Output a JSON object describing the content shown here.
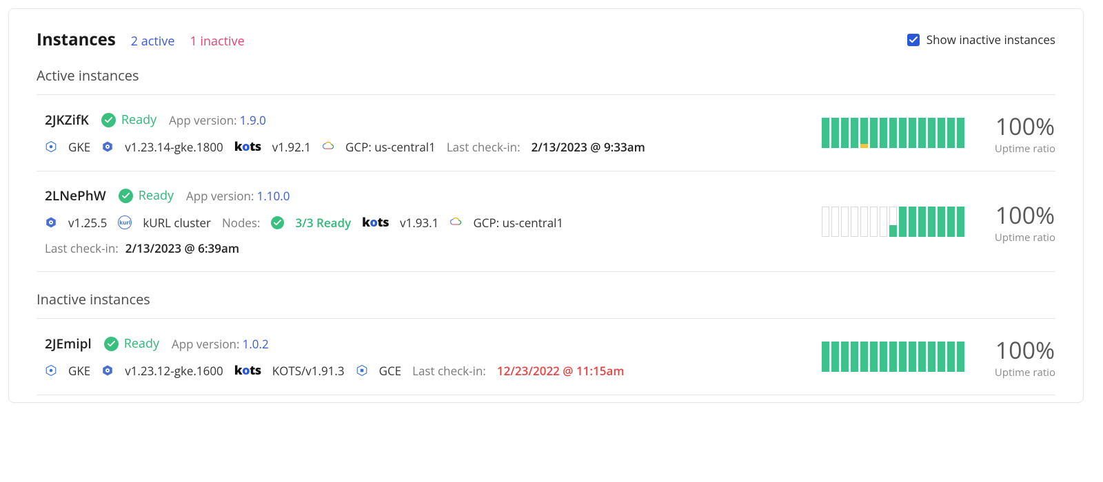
{
  "header": {
    "title": "Instances",
    "active_count": "2 active",
    "inactive_count": "1 inactive",
    "show_inactive_label": "Show inactive instances",
    "show_inactive_checked": true
  },
  "sections": {
    "active_title": "Active instances",
    "inactive_title": "Inactive instances"
  },
  "labels": {
    "app_version": "App version:",
    "nodes": "Nodes:",
    "last_checkin": "Last check-in:",
    "uptime_ratio": "Uptime ratio"
  },
  "instances": {
    "a": {
      "id": "2JKZifK",
      "status": "Ready",
      "app_version": "1.9.0",
      "platform": "GKE",
      "k8s_version": "v1.23.14-gke.1800",
      "kots_version": "v1.92.1",
      "cloud": "GCP: us-central1",
      "last_checkin": "2/13/2023 @ 9:33am",
      "uptime_pct": "100%"
    },
    "b": {
      "id": "2LNePhW",
      "status": "Ready",
      "app_version": "1.10.0",
      "k8s_version": "v1.25.5",
      "cluster_type": "kURL cluster",
      "nodes_ready": "3/3 Ready",
      "kots_version": "v1.93.1",
      "cloud": "GCP: us-central1",
      "last_checkin": "2/13/2023 @ 6:39am",
      "uptime_pct": "100%"
    },
    "c": {
      "id": "2JEmipl",
      "status": "Ready",
      "app_version": "1.0.2",
      "platform": "GKE",
      "k8s_version": "v1.23.12-gke.1600",
      "kots_version": "KOTS/v1.91.3",
      "cloud": "GCE",
      "last_checkin": "12/23/2022 @ 11:15am",
      "uptime_pct": "100%"
    }
  }
}
